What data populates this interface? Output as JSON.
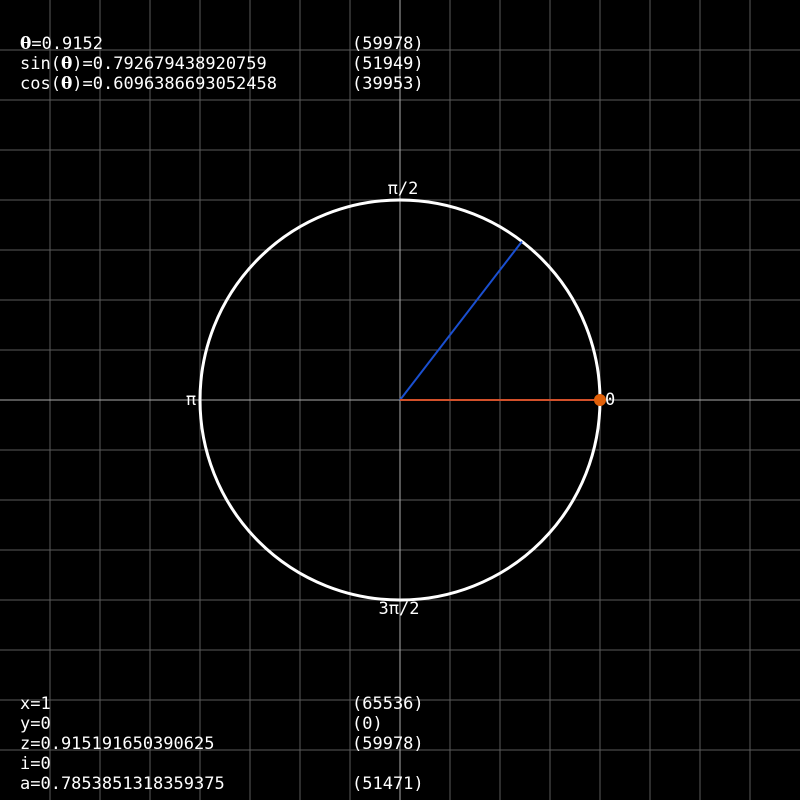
{
  "theme": {
    "background": "#000000",
    "grid_color": "#5a5a5a",
    "axis_color": "#aaaaaa",
    "circle_color": "#ffffff",
    "angle_line_color": "#1a4fd0",
    "radius_line_color": "#d2502a",
    "marker_color": "#e0600a"
  },
  "readouts_top": [
    {
      "symbol": "θ",
      "prefix": "",
      "suffix": "=0.9152",
      "raw": "(59978)"
    },
    {
      "symbol": "θ",
      "prefix": "sin(",
      "suffix": ")=0.792679438920759",
      "raw": "(51949)"
    },
    {
      "symbol": "θ",
      "prefix": "cos(",
      "suffix": ")=0.6096386693052458",
      "raw": "(39953)"
    }
  ],
  "readouts_bottom": [
    {
      "text": "x=1",
      "raw": "(65536)"
    },
    {
      "text": "y=0",
      "raw": "(0)"
    },
    {
      "text": "z=0.915191650390625",
      "raw": "(59978)"
    },
    {
      "text": "i=0",
      "raw": ""
    },
    {
      "text": "a=0.7853851318359375",
      "raw": "(51471)"
    }
  ],
  "unit_circle": {
    "angle_radians": 0.9152,
    "marker_x": 1,
    "marker_y": 0,
    "labels": {
      "top": "π/2",
      "left": "π",
      "right": "0",
      "bottom": "3π/2"
    }
  }
}
